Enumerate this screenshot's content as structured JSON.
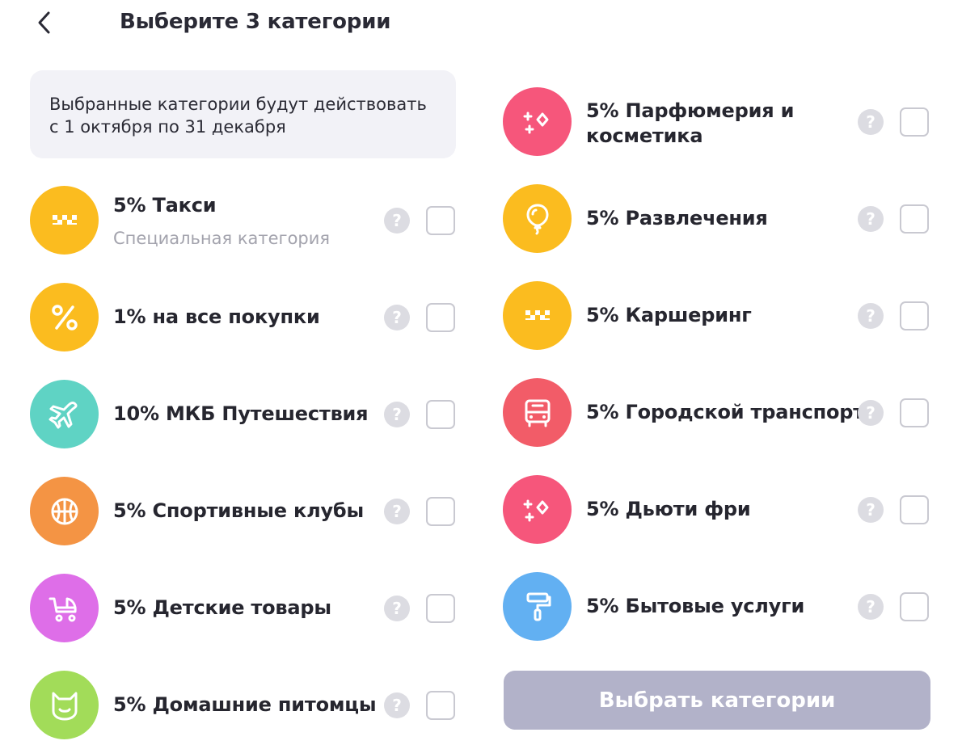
{
  "header": {
    "title": "Выберите 3 категории",
    "back_icon": "chevron-left-icon"
  },
  "info": {
    "line1": "Выбранные категории будут действовать",
    "line2": "с 1 октября по 31 декабря"
  },
  "help_glyph": "?",
  "left_categories": [
    {
      "label": "5% Такси",
      "sublabel": "Специальная категория",
      "icon": "taxi-icon",
      "color": "#fbbc1f",
      "checked": false
    },
    {
      "label": "1% на все покупки",
      "icon": "percent-icon",
      "color": "#fbbc1f",
      "checked": false
    },
    {
      "label": "10% МКБ Путешествия",
      "icon": "airplane-icon",
      "color": "#5fd3c4",
      "checked": false
    },
    {
      "label": "5% Спортивные клубы",
      "icon": "basketball-icon",
      "color": "#f49444",
      "checked": false
    },
    {
      "label": "5% Детские товары",
      "icon": "stroller-icon",
      "color": "#de6ee8",
      "checked": false
    },
    {
      "label": "5% Домашние питомцы",
      "icon": "cat-icon",
      "color": "#a2dc59",
      "checked": false
    }
  ],
  "right_categories": [
    {
      "label": "5% Парфюмерия и косметика",
      "icon": "sparkle-icon",
      "color": "#f6567b",
      "checked": false
    },
    {
      "label": "5% Развлечения",
      "icon": "balloon-icon",
      "color": "#fbbc1f",
      "checked": false
    },
    {
      "label": "5% Каршеринг",
      "icon": "taxi-icon",
      "color": "#fbbc1f",
      "checked": false
    },
    {
      "label": "5% Городской транспорт",
      "icon": "bus-icon",
      "color": "#f25c68",
      "checked": false
    },
    {
      "label": "5% Дьюти фри",
      "icon": "sparkle-icon",
      "color": "#f6567b",
      "checked": false
    },
    {
      "label": "5% Бытовые услуги",
      "icon": "paint-roller-icon",
      "color": "#62b0f2",
      "checked": false
    }
  ],
  "submit_label": "Выбрать категории",
  "colors": {
    "submit_disabled": "#b2b2c9",
    "info_bg": "#f2f2f7",
    "checkbox_border": "#c9c9d1"
  }
}
